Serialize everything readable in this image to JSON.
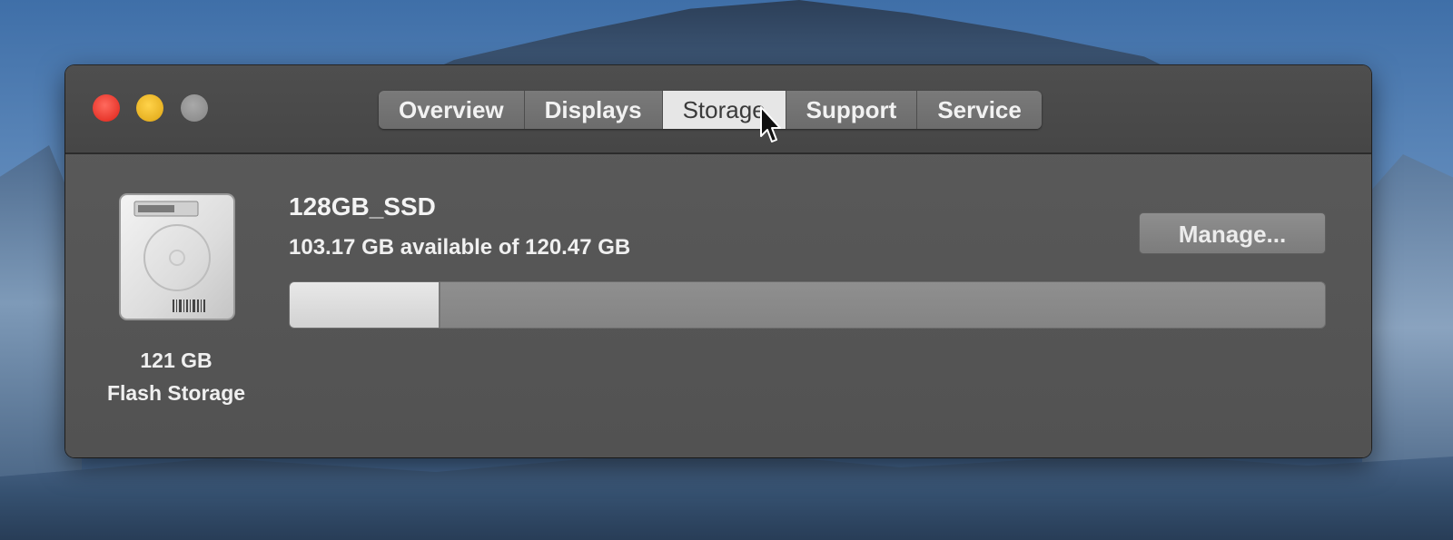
{
  "window": {
    "traffic_lights": [
      "close",
      "minimize",
      "zoom"
    ],
    "tabs": [
      {
        "label": "Overview",
        "active": false
      },
      {
        "label": "Displays",
        "active": false
      },
      {
        "label": "Storage",
        "active": true
      },
      {
        "label": "Support",
        "active": false
      },
      {
        "label": "Service",
        "active": false
      }
    ]
  },
  "storage": {
    "drive": {
      "icon": "hard-drive-icon",
      "size": "121 GB",
      "kind": "Flash Storage"
    },
    "volume": {
      "name": "128GB_SSD",
      "available_text": "103.17 GB available of 120.47 GB",
      "used_fraction": 0.144
    },
    "manage_label": "Manage..."
  },
  "colors": {
    "close": "#e8372c",
    "minimize": "#e8b223",
    "zoom": "#8c8c8c",
    "active_tab": "#e6e6e6",
    "window_bg": "#575757"
  }
}
